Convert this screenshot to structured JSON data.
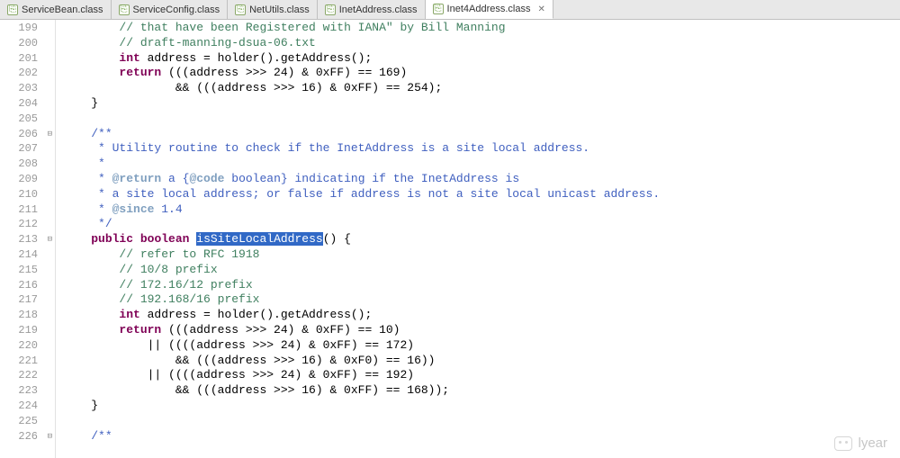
{
  "tabs": [
    {
      "label": "ServiceBean.class",
      "active": false
    },
    {
      "label": "ServiceConfig.class",
      "active": false
    },
    {
      "label": "NetUtils.class",
      "active": false
    },
    {
      "label": "InetAddress.class",
      "active": false
    },
    {
      "label": "Inet4Address.class",
      "active": true
    }
  ],
  "line_start": 199,
  "line_end": 226,
  "fold_lines": [
    206,
    213,
    226
  ],
  "highlight_line": 213,
  "selection": "isSiteLocalAddress",
  "code_lines": [
    {
      "n": 199,
      "seg": [
        [
          "sp",
          "        "
        ],
        [
          "cm",
          "// that have been Registered with IANA\" by Bill Manning"
        ]
      ]
    },
    {
      "n": 200,
      "seg": [
        [
          "sp",
          "        "
        ],
        [
          "cm",
          "// draft-manning-dsua-06.txt"
        ]
      ]
    },
    {
      "n": 201,
      "seg": [
        [
          "sp",
          "        "
        ],
        [
          "kw",
          "int"
        ],
        [
          "tx",
          " address = holder().getAddress();"
        ]
      ]
    },
    {
      "n": 202,
      "seg": [
        [
          "sp",
          "        "
        ],
        [
          "kw",
          "return"
        ],
        [
          "tx",
          " (((address >>> 24) & 0xFF) == 169)"
        ]
      ]
    },
    {
      "n": 203,
      "seg": [
        [
          "sp",
          "                "
        ],
        [
          "tx",
          "&& (((address >>> 16) & 0xFF) == 254);"
        ]
      ]
    },
    {
      "n": 204,
      "seg": [
        [
          "sp",
          "    "
        ],
        [
          "tx",
          "}"
        ]
      ]
    },
    {
      "n": 205,
      "seg": []
    },
    {
      "n": 206,
      "seg": [
        [
          "sp",
          "    "
        ],
        [
          "jd",
          "/**"
        ]
      ]
    },
    {
      "n": 207,
      "seg": [
        [
          "sp",
          "     "
        ],
        [
          "jd",
          "* Utility routine to check if the InetAddress is a site local address."
        ]
      ]
    },
    {
      "n": 208,
      "seg": [
        [
          "sp",
          "     "
        ],
        [
          "jd",
          "*"
        ]
      ]
    },
    {
      "n": 209,
      "seg": [
        [
          "sp",
          "     "
        ],
        [
          "jd",
          "* "
        ],
        [
          "jt",
          "@return"
        ],
        [
          "jd",
          " a {"
        ],
        [
          "jt",
          "@code"
        ],
        [
          "jd",
          " boolean} indicating if the InetAddress is"
        ]
      ]
    },
    {
      "n": 210,
      "seg": [
        [
          "sp",
          "     "
        ],
        [
          "jd",
          "* a site local address; or false if address is not a site local unicast address."
        ]
      ]
    },
    {
      "n": 211,
      "seg": [
        [
          "sp",
          "     "
        ],
        [
          "jd",
          "* "
        ],
        [
          "jt",
          "@since"
        ],
        [
          "jd",
          " 1.4"
        ]
      ]
    },
    {
      "n": 212,
      "seg": [
        [
          "sp",
          "     "
        ],
        [
          "jd",
          "*/"
        ]
      ]
    },
    {
      "n": 213,
      "seg": [
        [
          "sp",
          "    "
        ],
        [
          "kw",
          "public"
        ],
        [
          "tx",
          " "
        ],
        [
          "kw",
          "boolean"
        ],
        [
          "tx",
          " "
        ],
        [
          "sel",
          "isSiteLocalAddress"
        ],
        [
          "tx",
          "() {"
        ]
      ]
    },
    {
      "n": 214,
      "seg": [
        [
          "sp",
          "        "
        ],
        [
          "cm",
          "// refer to RFC 1918"
        ]
      ]
    },
    {
      "n": 215,
      "seg": [
        [
          "sp",
          "        "
        ],
        [
          "cm",
          "// 10/8 prefix"
        ]
      ]
    },
    {
      "n": 216,
      "seg": [
        [
          "sp",
          "        "
        ],
        [
          "cm",
          "// 172.16/12 prefix"
        ]
      ]
    },
    {
      "n": 217,
      "seg": [
        [
          "sp",
          "        "
        ],
        [
          "cm",
          "// 192.168/16 prefix"
        ]
      ]
    },
    {
      "n": 218,
      "seg": [
        [
          "sp",
          "        "
        ],
        [
          "kw",
          "int"
        ],
        [
          "tx",
          " address = holder().getAddress();"
        ]
      ]
    },
    {
      "n": 219,
      "seg": [
        [
          "sp",
          "        "
        ],
        [
          "kw",
          "return"
        ],
        [
          "tx",
          " (((address >>> 24) & 0xFF) == 10)"
        ]
      ]
    },
    {
      "n": 220,
      "seg": [
        [
          "sp",
          "            "
        ],
        [
          "tx",
          "|| ((((address >>> 24) & 0xFF) == 172)"
        ]
      ]
    },
    {
      "n": 221,
      "seg": [
        [
          "sp",
          "                "
        ],
        [
          "tx",
          "&& (((address >>> 16) & 0xF0) == 16))"
        ]
      ]
    },
    {
      "n": 222,
      "seg": [
        [
          "sp",
          "            "
        ],
        [
          "tx",
          "|| ((((address >>> 24) & 0xFF) == 192)"
        ]
      ]
    },
    {
      "n": 223,
      "seg": [
        [
          "sp",
          "                "
        ],
        [
          "tx",
          "&& (((address >>> 16) & 0xFF) == 168));"
        ]
      ]
    },
    {
      "n": 224,
      "seg": [
        [
          "sp",
          "    "
        ],
        [
          "tx",
          "}"
        ]
      ]
    },
    {
      "n": 225,
      "seg": []
    },
    {
      "n": 226,
      "seg": [
        [
          "sp",
          "    "
        ],
        [
          "jd",
          "/**"
        ]
      ]
    }
  ],
  "watermark": "lyear"
}
